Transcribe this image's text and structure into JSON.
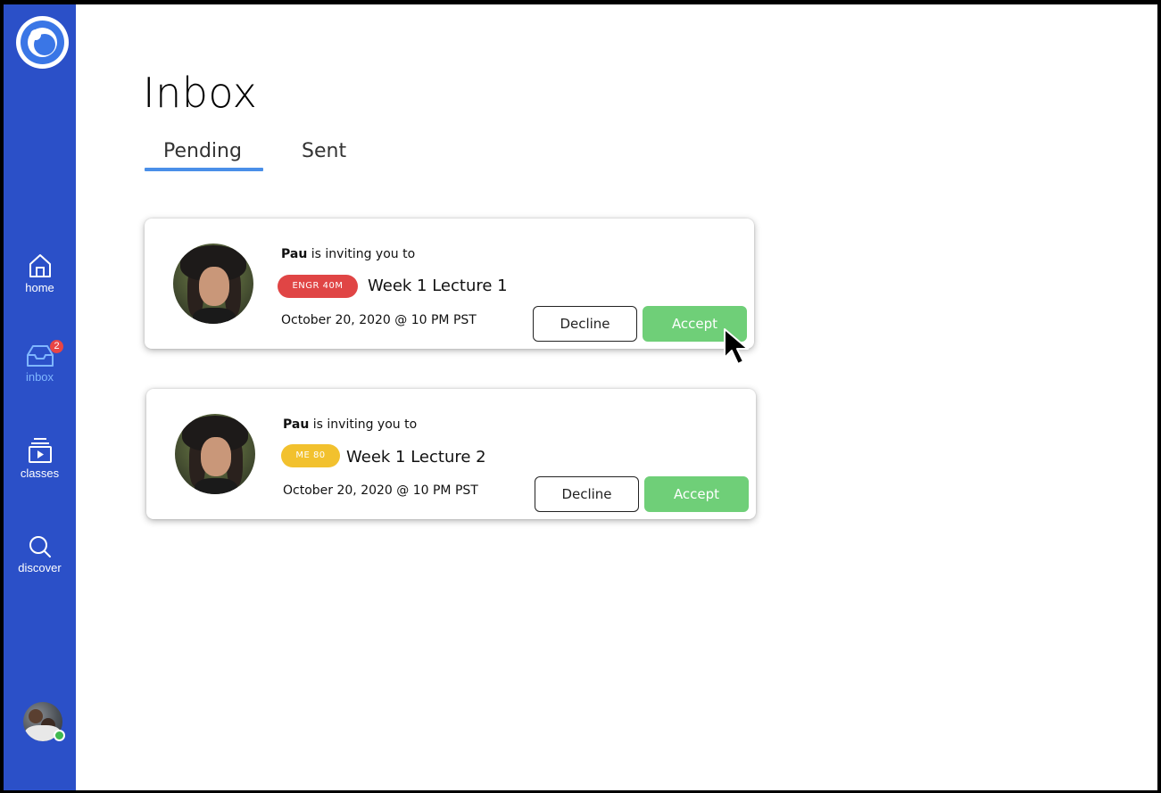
{
  "sidebar": {
    "nav": [
      {
        "label": "home",
        "icon": "home-icon"
      },
      {
        "label": "inbox",
        "icon": "inbox-icon",
        "badge": "2",
        "active": true
      },
      {
        "label": "classes",
        "icon": "classes-icon"
      },
      {
        "label": "discover",
        "icon": "search-icon"
      }
    ],
    "active_color": "#7fb6ff",
    "background": "#2b50c8"
  },
  "main": {
    "title": "Inbox",
    "tabs": [
      {
        "label": "Pending",
        "active": true
      },
      {
        "label": "Sent",
        "active": false
      }
    ]
  },
  "invites": [
    {
      "inviter": "Pau",
      "text": " is inviting you to",
      "course": "ENGR 40M",
      "course_color": "#e04545",
      "lecture": "Week 1 Lecture 1",
      "date": "October 20, 2020 @ 10 PM PST",
      "decline_label": "Decline",
      "accept_label": "Accept"
    },
    {
      "inviter": "Pau",
      "text": " is inviting you to",
      "course": "ME 80",
      "course_color": "#f2c12e",
      "lecture": "Week 1 Lecture 2",
      "date": "October 20, 2020 @ 10 PM PST",
      "decline_label": "Decline",
      "accept_label": "Accept"
    }
  ],
  "colors": {
    "accept": "#6fcf78",
    "tab_underline": "#4a8fe8",
    "online_status": "#3fb950"
  }
}
